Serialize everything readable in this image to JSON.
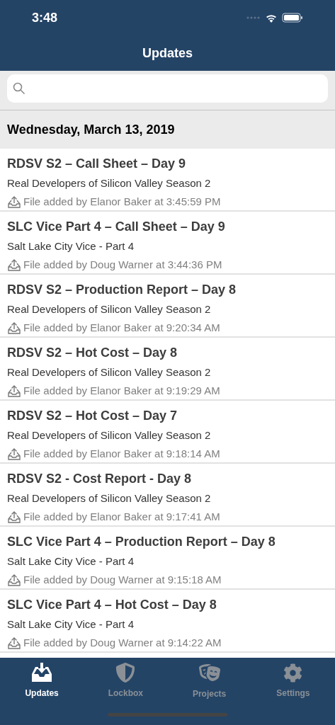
{
  "status_bar": {
    "time": "3:48"
  },
  "nav": {
    "title": "Updates"
  },
  "section": {
    "title": "Wednesday, March 13, 2019"
  },
  "updates": [
    {
      "title": "RDSV S2 – Call Sheet – Day 9",
      "project": "Real Developers of Silicon Valley Season 2",
      "detail": "File added by Elanor Baker at 3:45:59 PM"
    },
    {
      "title": "SLC Vice Part 4 – Call Sheet – Day 9",
      "project": "Salt Lake City Vice - Part 4",
      "detail": "File added by Doug Warner at 3:44:36 PM"
    },
    {
      "title": "RDSV S2 – Production Report – Day 8",
      "project": "Real Developers of Silicon Valley Season 2",
      "detail": "File added by Elanor Baker at 9:20:34 AM"
    },
    {
      "title": "RDSV S2 – Hot Cost – Day 8",
      "project": "Real Developers of Silicon Valley Season 2",
      "detail": "File added by Elanor Baker at 9:19:29 AM"
    },
    {
      "title": "RDSV S2 – Hot Cost – Day 7",
      "project": "Real Developers of Silicon Valley Season 2",
      "detail": "File added by Elanor Baker at 9:18:14 AM"
    },
    {
      "title": "RDSV S2 - Cost Report - Day 8",
      "project": "Real Developers of Silicon Valley Season 2",
      "detail": "File added by Elanor Baker at 9:17:41 AM"
    },
    {
      "title": "SLC Vice Part 4 – Production Report – Day 8",
      "project": "Salt Lake City Vice - Part 4",
      "detail": "File added by Doug Warner at 9:15:18 AM"
    },
    {
      "title": "SLC Vice Part 4 – Hot Cost – Day 8",
      "project": "Salt Lake City Vice - Part 4",
      "detail": "File added by Doug Warner at 9:14:22 AM"
    }
  ],
  "tabs": [
    {
      "label": "Updates",
      "kind": "inbox",
      "selected": true
    },
    {
      "label": "Lockbox",
      "kind": "shield",
      "selected": false
    },
    {
      "label": "Projects",
      "kind": "masks",
      "selected": false
    },
    {
      "label": "Settings",
      "kind": "gear",
      "selected": false
    }
  ]
}
